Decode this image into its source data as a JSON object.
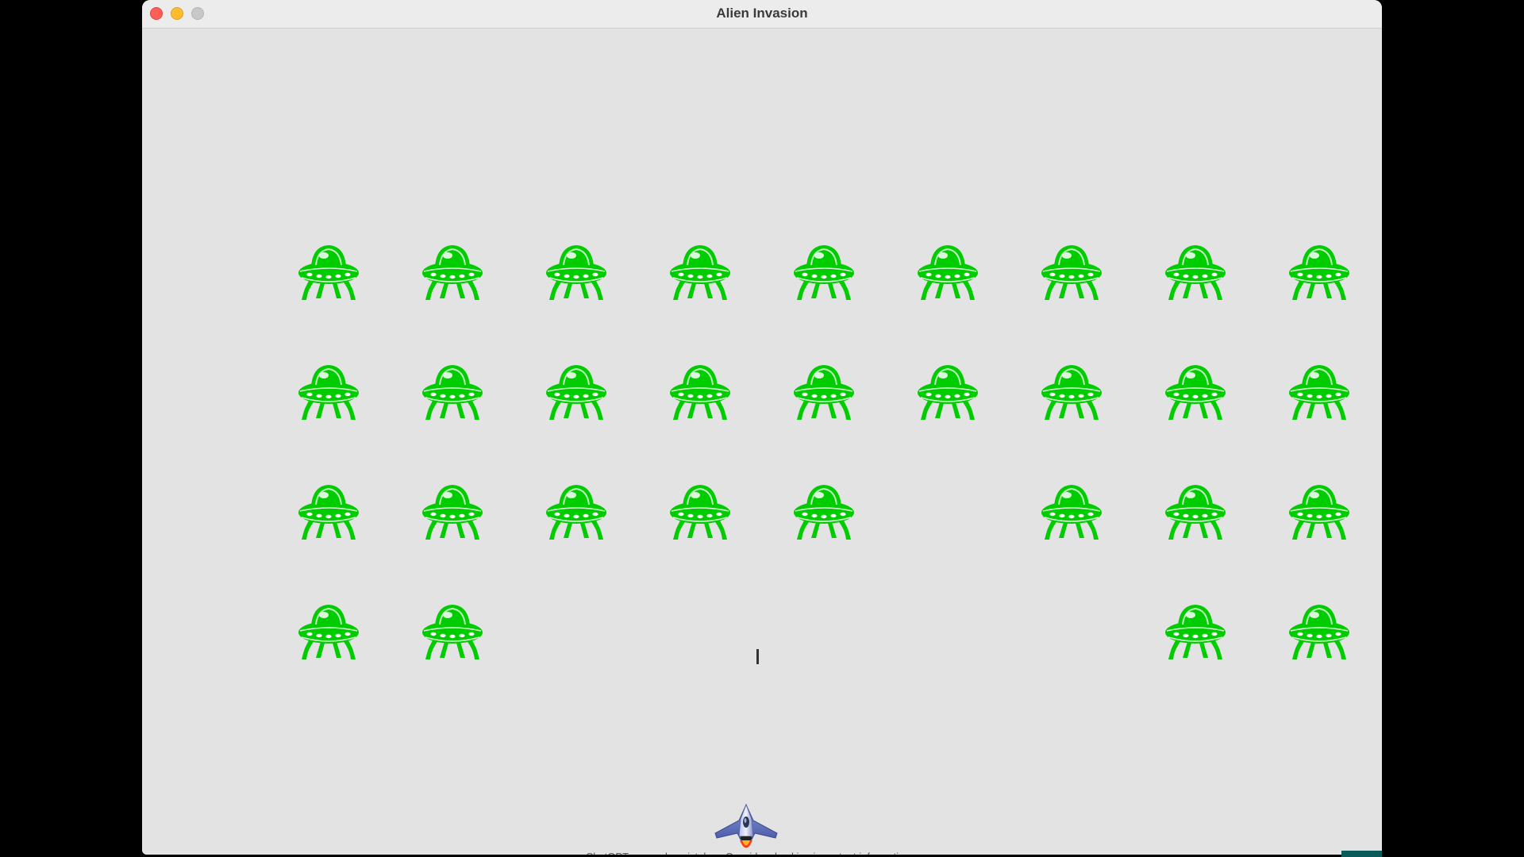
{
  "window": {
    "title": "Alien Invasion"
  },
  "game": {
    "alien_color": "#00cc00",
    "alien_grid": {
      "rows": 4,
      "columns": 9,
      "present": [
        [
          1,
          1,
          1,
          1,
          1,
          1,
          1,
          1,
          1
        ],
        [
          1,
          1,
          1,
          1,
          1,
          1,
          1,
          1,
          1
        ],
        [
          1,
          1,
          1,
          1,
          1,
          0,
          1,
          1,
          1
        ],
        [
          1,
          1,
          0,
          0,
          0,
          0,
          0,
          1,
          1
        ]
      ]
    },
    "bullet_color": "#333333",
    "ship_icon": "rocket-ship-icon",
    "alien_icon": "ufo-alien-icon"
  },
  "footer": {
    "note": "ChatGPT can make mistakes. Consider checking important information."
  }
}
